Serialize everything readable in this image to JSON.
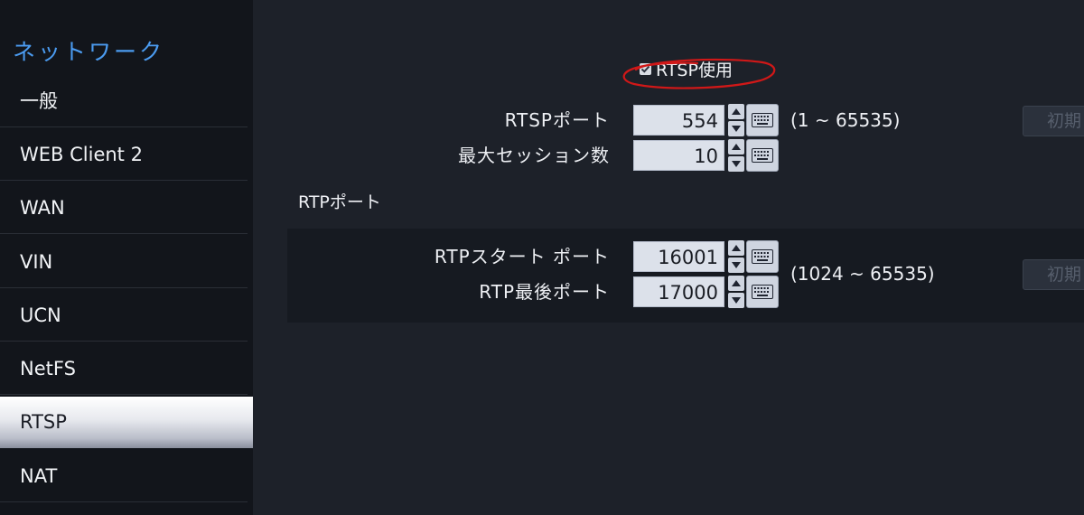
{
  "sidebar": {
    "title": "ネットワーク",
    "items": [
      {
        "label": "一般"
      },
      {
        "label": "WEB Client 2"
      },
      {
        "label": "WAN"
      },
      {
        "label": "VIN"
      },
      {
        "label": "UCN"
      },
      {
        "label": "NetFS"
      },
      {
        "label": "RTSP",
        "active": true
      },
      {
        "label": "NAT"
      }
    ]
  },
  "rtsp": {
    "enable_label": "RTSP使用",
    "enable_checked": true,
    "port_label": "RTSPポート",
    "port_value": "554",
    "port_range": "(1 ~ 65535)",
    "max_sessions_label": "最大セッション数",
    "max_sessions_value": "10",
    "reset_label": "初期"
  },
  "rtp": {
    "section_title": "RTPポート",
    "start_label": "RTPスタート ポート",
    "start_value": "16001",
    "end_label": "RTP最後ポート",
    "end_value": "17000",
    "range": "(1024 ~ 65535)",
    "reset_label": "初期"
  },
  "colors": {
    "background": "#1d2129",
    "sidebar": "#12151b",
    "accent_title": "#4b9bf0",
    "annotation_circle": "#d01818"
  }
}
